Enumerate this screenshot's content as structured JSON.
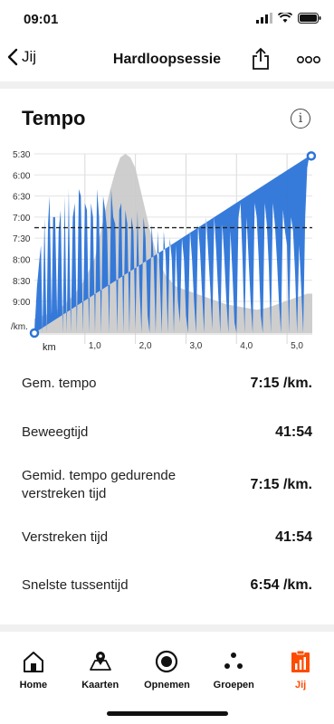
{
  "status_bar": {
    "time": "09:01",
    "signal_icon": "signal-icon",
    "wifi_icon": "wifi-icon",
    "battery_icon": "battery-icon"
  },
  "nav": {
    "back_label": "Jij",
    "title": "Hardloopsessie",
    "back_icon": "chevron-left-icon",
    "share_icon": "share-icon",
    "more_icon": "more-icon"
  },
  "card": {
    "title": "Tempo",
    "info_icon": "info-icon"
  },
  "chart_data": {
    "type": "area",
    "title": "",
    "xlabel": "km",
    "ylabel": "/km.",
    "x_ticks": [
      "1,0",
      "2,0",
      "3,0",
      "4,0",
      "5,0"
    ],
    "y_ticks": [
      "5:30",
      "6:00",
      "6:30",
      "7:00",
      "7:30",
      "8:00",
      "8:30",
      "9:00"
    ],
    "xlim": [
      0,
      5.5
    ],
    "ylim_seconds_per_km": [
      330,
      585
    ],
    "y_inverted": true,
    "average_line": "7:15",
    "accent_color": "#2c74d8",
    "elevation_color": "#c9c9c9",
    "series": [
      {
        "kind": "pace",
        "x": [
          0.0,
          0.05,
          0.1,
          0.13,
          0.16,
          0.2,
          0.24,
          0.27,
          0.3,
          0.34,
          0.37,
          0.41,
          0.45,
          0.48,
          0.52,
          0.56,
          0.6,
          0.64,
          0.68,
          0.72,
          0.76,
          0.8,
          0.84,
          0.88,
          0.92,
          0.96,
          1.0,
          1.04,
          1.08,
          1.12,
          1.16,
          1.2,
          1.24,
          1.28,
          1.32,
          1.36,
          1.4,
          1.44,
          1.48,
          1.52,
          1.56,
          1.6,
          1.64,
          1.68,
          1.72,
          1.76,
          1.8,
          1.84,
          1.88,
          1.92,
          1.96,
          2.0,
          2.04,
          2.08,
          2.12,
          2.16,
          2.2,
          2.24,
          2.28,
          2.32,
          2.36,
          2.4,
          2.44,
          2.48,
          2.52,
          2.56,
          2.6,
          2.64,
          2.68,
          2.72,
          2.76,
          2.8,
          2.84,
          2.88,
          2.92,
          2.96,
          3.0,
          3.04,
          3.08,
          3.12,
          3.16,
          3.2,
          3.24,
          3.28,
          3.32,
          3.36,
          3.4,
          3.44,
          3.48,
          3.52,
          3.56,
          3.6,
          3.64,
          3.68,
          3.72,
          3.76,
          3.8,
          3.84,
          3.88,
          3.92,
          3.96,
          4.0,
          4.04,
          4.08,
          4.12,
          4.16,
          4.2,
          4.24,
          4.28,
          4.32,
          4.36,
          4.4,
          4.44,
          4.48,
          4.52,
          4.56,
          4.6,
          4.64,
          4.68,
          4.72,
          4.76,
          4.8,
          4.84,
          4.88,
          4.92,
          4.96,
          5.0,
          5.04,
          5.08,
          5.12,
          5.16,
          5.2,
          5.24,
          5.28,
          5.32,
          5.36,
          5.4,
          5.44,
          5.48
        ],
        "pace_sec": [
          585,
          520,
          480,
          460,
          590,
          420,
          585,
          430,
          390,
          560,
          420,
          420,
          560,
          440,
          410,
          585,
          390,
          585,
          380,
          590,
          420,
          400,
          585,
          380,
          390,
          590,
          400,
          410,
          590,
          400,
          420,
          585,
          380,
          420,
          585,
          390,
          410,
          440,
          585,
          380,
          420,
          430,
          590,
          410,
          400,
          585,
          410,
          430,
          585,
          420,
          440,
          580,
          410,
          520,
          585,
          420,
          450,
          560,
          590,
          430,
          480,
          585,
          440,
          500,
          590,
          440,
          480,
          585,
          450,
          480,
          585,
          460,
          540,
          570,
          450,
          480,
          560,
          590,
          440,
          480,
          540,
          590,
          430,
          470,
          530,
          590,
          420,
          470,
          520,
          580,
          420,
          470,
          530,
          590,
          430,
          480,
          540,
          590,
          440,
          500,
          570,
          590,
          420,
          400,
          480,
          585,
          420,
          480,
          540,
          590,
          400,
          420,
          480,
          560,
          590,
          400,
          430,
          490,
          585,
          400,
          430,
          480,
          540,
          585,
          410,
          440,
          460,
          590,
          420,
          440,
          500,
          590,
          460,
          520,
          590,
          420,
          350,
          333
        ]
      },
      {
        "kind": "elevation",
        "x": [
          0.0,
          0.2,
          0.4,
          0.6,
          0.8,
          1.0,
          1.2,
          1.3,
          1.4,
          1.5,
          1.6,
          1.7,
          1.8,
          1.9,
          2.0,
          2.1,
          2.2,
          2.3,
          2.4,
          2.5,
          2.6,
          2.8,
          3.0,
          3.2,
          3.4,
          3.6,
          3.8,
          4.0,
          4.2,
          4.4,
          4.6,
          4.8,
          5.0,
          5.2,
          5.4,
          5.5
        ],
        "value_pct": [
          0.08,
          0.1,
          0.12,
          0.16,
          0.22,
          0.3,
          0.42,
          0.55,
          0.68,
          0.8,
          0.9,
          0.98,
          1.0,
          0.98,
          0.92,
          0.8,
          0.68,
          0.56,
          0.46,
          0.38,
          0.32,
          0.26,
          0.24,
          0.22,
          0.2,
          0.18,
          0.16,
          0.15,
          0.14,
          0.13,
          0.14,
          0.16,
          0.18,
          0.2,
          0.22,
          0.22
        ]
      }
    ],
    "endpoint_markers": [
      "start",
      "end"
    ]
  },
  "stats": [
    {
      "label": "Gem. tempo",
      "value": "7:15 /km."
    },
    {
      "label": "Beweegtijd",
      "value": "41:54"
    },
    {
      "label": "Gemid. tempo gedurende verstreken tijd",
      "value": "7:15 /km."
    },
    {
      "label": "Verstreken tijd",
      "value": "41:54"
    },
    {
      "label": "Snelste tussentijd",
      "value": "6:54 /km."
    }
  ],
  "tabs": [
    {
      "label": "Home",
      "icon": "home-icon",
      "active": false
    },
    {
      "label": "Kaarten",
      "icon": "map-icon",
      "active": false
    },
    {
      "label": "Opnemen",
      "icon": "record-icon",
      "active": false
    },
    {
      "label": "Groepen",
      "icon": "groups-icon",
      "active": false
    },
    {
      "label": "Jij",
      "icon": "you-icon",
      "active": true
    }
  ],
  "colors": {
    "accent": "#fc4c02",
    "chart_blue": "#2c74d8"
  }
}
